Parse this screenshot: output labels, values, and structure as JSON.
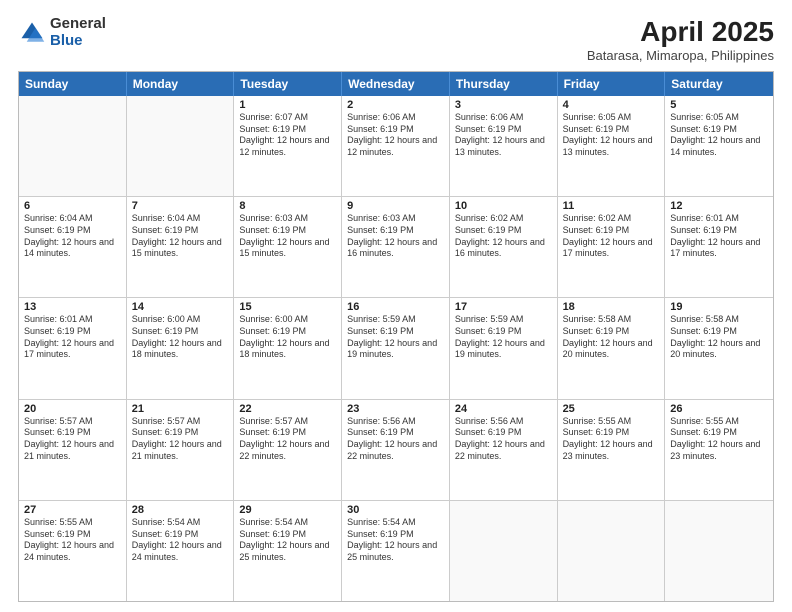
{
  "header": {
    "logo_general": "General",
    "logo_blue": "Blue",
    "title": "April 2025",
    "subtitle": "Batarasa, Mimaropa, Philippines"
  },
  "calendar": {
    "days_of_week": [
      "Sunday",
      "Monday",
      "Tuesday",
      "Wednesday",
      "Thursday",
      "Friday",
      "Saturday"
    ],
    "weeks": [
      [
        {
          "day": "",
          "info": ""
        },
        {
          "day": "",
          "info": ""
        },
        {
          "day": "1",
          "info": "Sunrise: 6:07 AM\nSunset: 6:19 PM\nDaylight: 12 hours and 12 minutes."
        },
        {
          "day": "2",
          "info": "Sunrise: 6:06 AM\nSunset: 6:19 PM\nDaylight: 12 hours and 12 minutes."
        },
        {
          "day": "3",
          "info": "Sunrise: 6:06 AM\nSunset: 6:19 PM\nDaylight: 12 hours and 13 minutes."
        },
        {
          "day": "4",
          "info": "Sunrise: 6:05 AM\nSunset: 6:19 PM\nDaylight: 12 hours and 13 minutes."
        },
        {
          "day": "5",
          "info": "Sunrise: 6:05 AM\nSunset: 6:19 PM\nDaylight: 12 hours and 14 minutes."
        }
      ],
      [
        {
          "day": "6",
          "info": "Sunrise: 6:04 AM\nSunset: 6:19 PM\nDaylight: 12 hours and 14 minutes."
        },
        {
          "day": "7",
          "info": "Sunrise: 6:04 AM\nSunset: 6:19 PM\nDaylight: 12 hours and 15 minutes."
        },
        {
          "day": "8",
          "info": "Sunrise: 6:03 AM\nSunset: 6:19 PM\nDaylight: 12 hours and 15 minutes."
        },
        {
          "day": "9",
          "info": "Sunrise: 6:03 AM\nSunset: 6:19 PM\nDaylight: 12 hours and 16 minutes."
        },
        {
          "day": "10",
          "info": "Sunrise: 6:02 AM\nSunset: 6:19 PM\nDaylight: 12 hours and 16 minutes."
        },
        {
          "day": "11",
          "info": "Sunrise: 6:02 AM\nSunset: 6:19 PM\nDaylight: 12 hours and 17 minutes."
        },
        {
          "day": "12",
          "info": "Sunrise: 6:01 AM\nSunset: 6:19 PM\nDaylight: 12 hours and 17 minutes."
        }
      ],
      [
        {
          "day": "13",
          "info": "Sunrise: 6:01 AM\nSunset: 6:19 PM\nDaylight: 12 hours and 17 minutes."
        },
        {
          "day": "14",
          "info": "Sunrise: 6:00 AM\nSunset: 6:19 PM\nDaylight: 12 hours and 18 minutes."
        },
        {
          "day": "15",
          "info": "Sunrise: 6:00 AM\nSunset: 6:19 PM\nDaylight: 12 hours and 18 minutes."
        },
        {
          "day": "16",
          "info": "Sunrise: 5:59 AM\nSunset: 6:19 PM\nDaylight: 12 hours and 19 minutes."
        },
        {
          "day": "17",
          "info": "Sunrise: 5:59 AM\nSunset: 6:19 PM\nDaylight: 12 hours and 19 minutes."
        },
        {
          "day": "18",
          "info": "Sunrise: 5:58 AM\nSunset: 6:19 PM\nDaylight: 12 hours and 20 minutes."
        },
        {
          "day": "19",
          "info": "Sunrise: 5:58 AM\nSunset: 6:19 PM\nDaylight: 12 hours and 20 minutes."
        }
      ],
      [
        {
          "day": "20",
          "info": "Sunrise: 5:57 AM\nSunset: 6:19 PM\nDaylight: 12 hours and 21 minutes."
        },
        {
          "day": "21",
          "info": "Sunrise: 5:57 AM\nSunset: 6:19 PM\nDaylight: 12 hours and 21 minutes."
        },
        {
          "day": "22",
          "info": "Sunrise: 5:57 AM\nSunset: 6:19 PM\nDaylight: 12 hours and 22 minutes."
        },
        {
          "day": "23",
          "info": "Sunrise: 5:56 AM\nSunset: 6:19 PM\nDaylight: 12 hours and 22 minutes."
        },
        {
          "day": "24",
          "info": "Sunrise: 5:56 AM\nSunset: 6:19 PM\nDaylight: 12 hours and 22 minutes."
        },
        {
          "day": "25",
          "info": "Sunrise: 5:55 AM\nSunset: 6:19 PM\nDaylight: 12 hours and 23 minutes."
        },
        {
          "day": "26",
          "info": "Sunrise: 5:55 AM\nSunset: 6:19 PM\nDaylight: 12 hours and 23 minutes."
        }
      ],
      [
        {
          "day": "27",
          "info": "Sunrise: 5:55 AM\nSunset: 6:19 PM\nDaylight: 12 hours and 24 minutes."
        },
        {
          "day": "28",
          "info": "Sunrise: 5:54 AM\nSunset: 6:19 PM\nDaylight: 12 hours and 24 minutes."
        },
        {
          "day": "29",
          "info": "Sunrise: 5:54 AM\nSunset: 6:19 PM\nDaylight: 12 hours and 25 minutes."
        },
        {
          "day": "30",
          "info": "Sunrise: 5:54 AM\nSunset: 6:19 PM\nDaylight: 12 hours and 25 minutes."
        },
        {
          "day": "",
          "info": ""
        },
        {
          "day": "",
          "info": ""
        },
        {
          "day": "",
          "info": ""
        }
      ]
    ]
  }
}
